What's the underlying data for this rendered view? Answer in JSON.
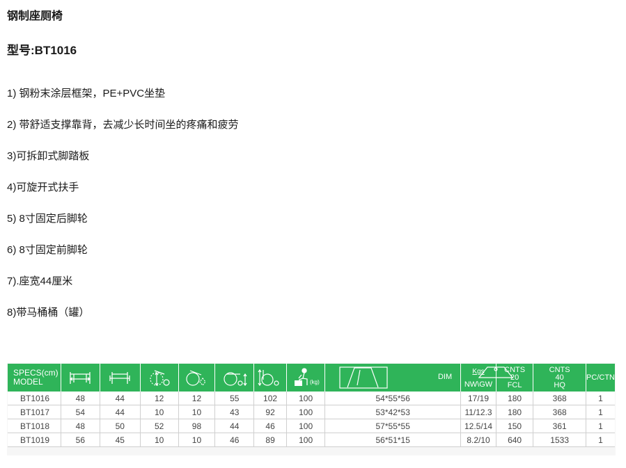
{
  "title": "钢制座厕椅",
  "model_line": "型号:BT1016",
  "features": [
    "1) 钢粉末涂层框架，PE+PVC坐垫",
    "2) 带舒适支撑靠背，去减少长时间坐的疼痛和疲劳",
    "3)可拆卸式脚踏板",
    "4)可旋开式扶手",
    "5) 8寸固定后脚轮",
    "6) 8寸固定前脚轮",
    "7).座宽44厘米",
    "8)带马桶桶（罐）"
  ],
  "spec_table": {
    "header_color": "#2fb459",
    "specs_line1": "SPECS(cm)",
    "specs_line2": "MODEL",
    "icons": [
      "overall-width-icon",
      "seat-width-icon",
      "rear-wheel-icon",
      "front-wheel-icon",
      "seat-height-icon",
      "overall-height-icon",
      "max-load-icon"
    ],
    "load_unit": "(kg)",
    "dim_label": "DIM",
    "kgs_label": "Kgs",
    "nwgw_label": "NW\\GW",
    "cnts20": [
      "CNTS",
      "20",
      "FCL"
    ],
    "cnts40": [
      "CNTS",
      "40",
      "HQ"
    ],
    "pcctn_label": "PC/CTN",
    "rows": [
      [
        "BT1016",
        "48",
        "44",
        "12",
        "12",
        "55",
        "102",
        "100",
        "54*55*56",
        "17/19",
        "180",
        "368",
        "1"
      ],
      [
        "BT1017",
        "54",
        "44",
        "10",
        "10",
        "43",
        "92",
        "100",
        "53*42*53",
        "11/12.3",
        "180",
        "368",
        "1"
      ],
      [
        "BT1018",
        "48",
        "50",
        "52",
        "98",
        "44",
        "46",
        "100",
        "57*55*55",
        "12.5/14",
        "150",
        "361",
        "1"
      ],
      [
        "BT1019",
        "56",
        "45",
        "10",
        "10",
        "46",
        "89",
        "100",
        "56*51*15",
        "8.2/10",
        "640",
        "1533",
        "1"
      ]
    ]
  }
}
